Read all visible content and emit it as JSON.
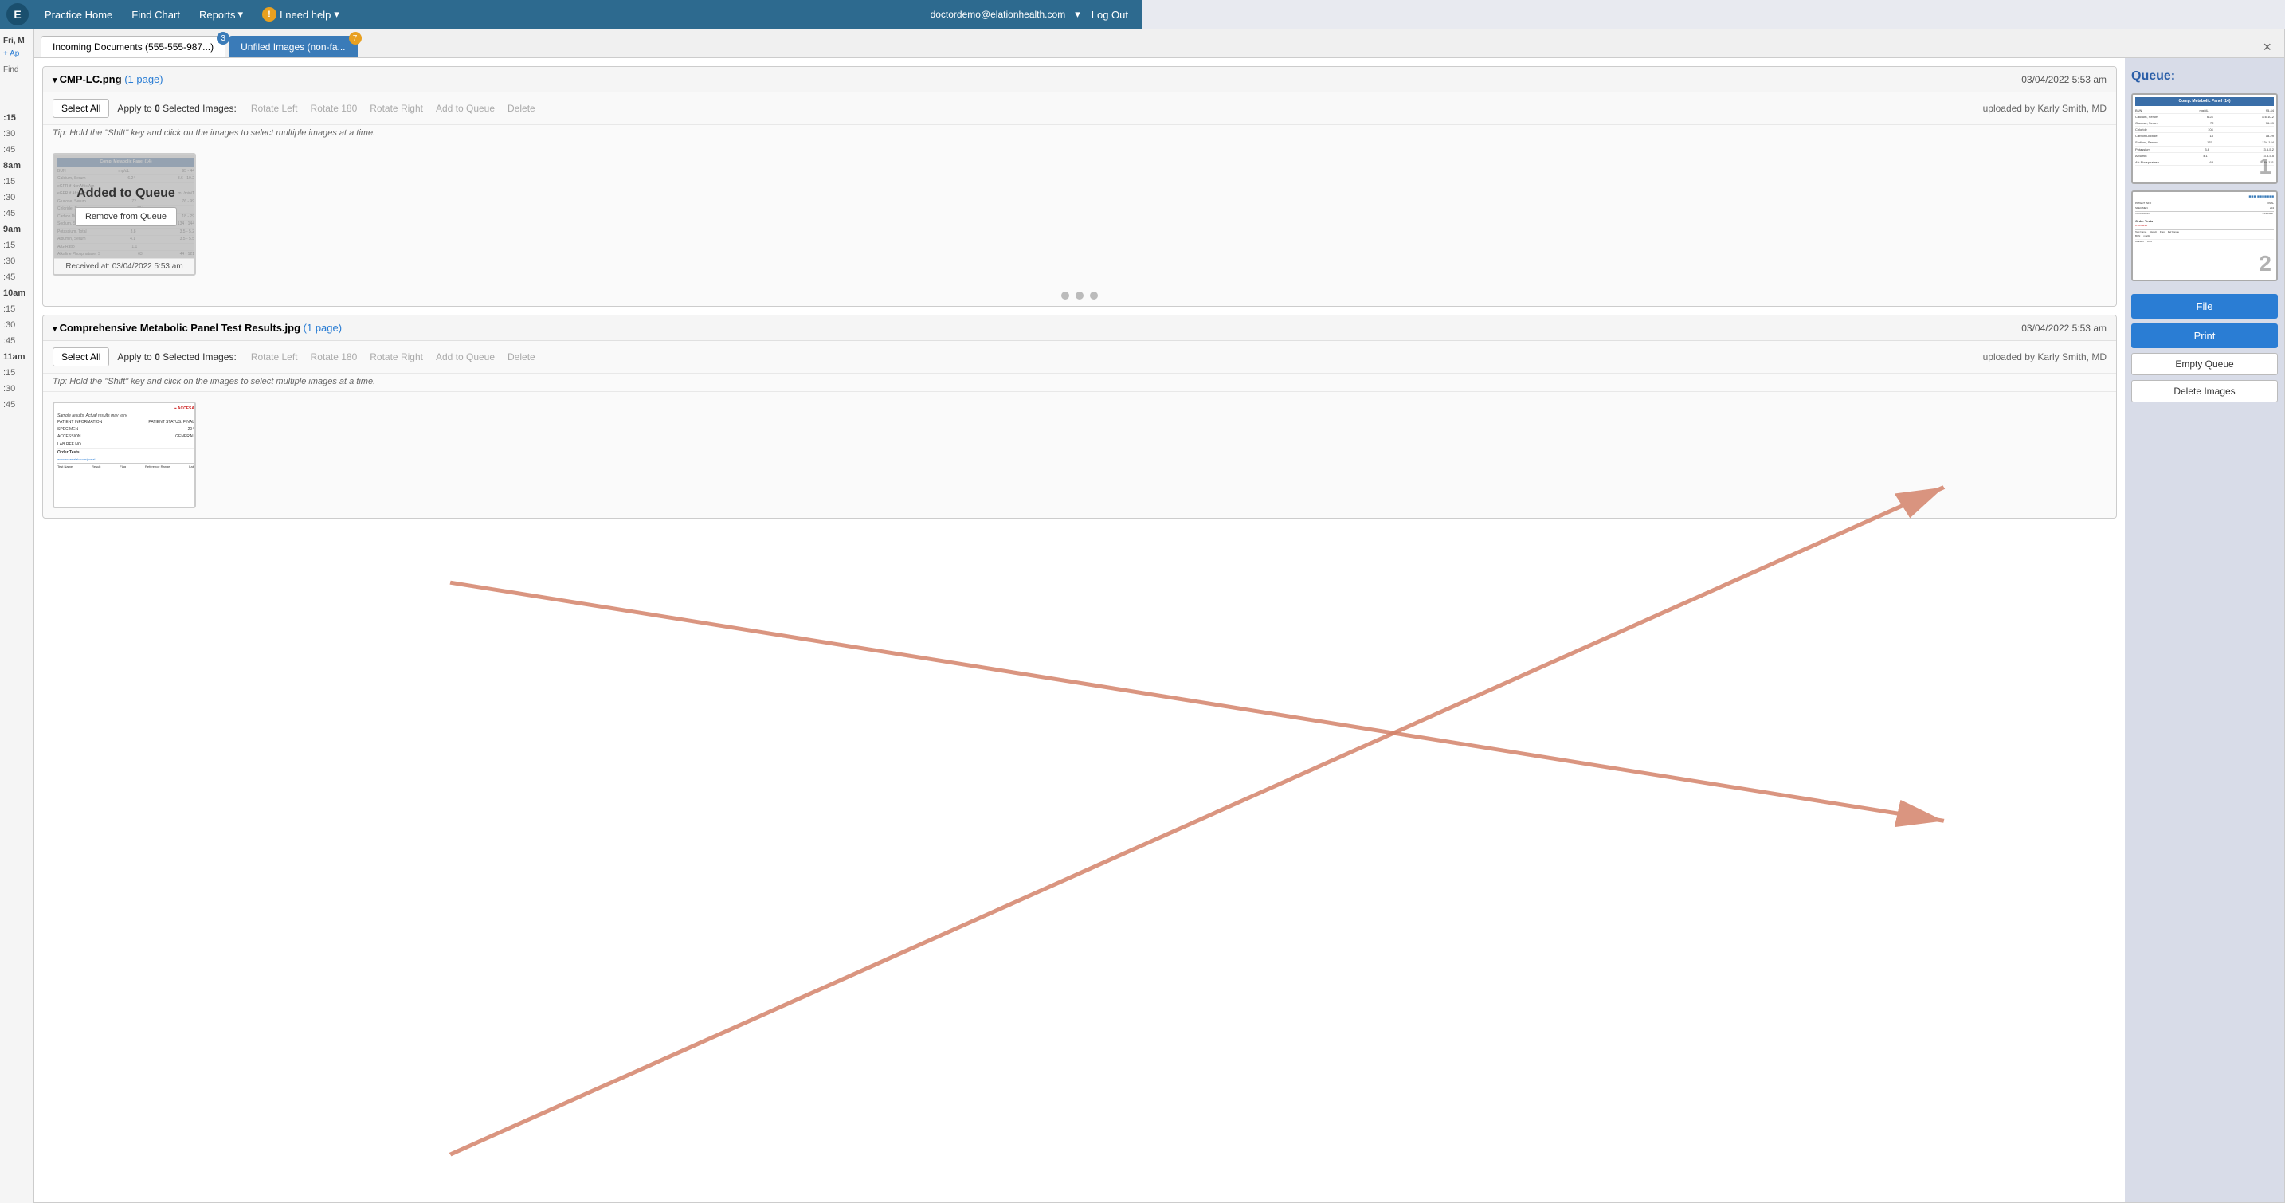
{
  "nav": {
    "logo": "E",
    "links": [
      {
        "label": "Practice Home",
        "id": "practice-home"
      },
      {
        "label": "Find Chart",
        "id": "find-chart"
      },
      {
        "label": "Reports",
        "id": "reports",
        "dropdown": true
      },
      {
        "label": "I need help",
        "id": "i-need-help",
        "dropdown": true,
        "has_help_icon": true
      }
    ],
    "user_email": "doctordemo@elationhealth.com",
    "logout_label": "Log Out"
  },
  "tabs": [
    {
      "label": "Incoming Documents (555-555-987...)",
      "id": "incoming-docs",
      "badge": "3",
      "active": false
    },
    {
      "label": "Unfiled Images (non-fa...",
      "id": "unfiled-images",
      "badge": "7",
      "active": true
    }
  ],
  "close_button": "×",
  "sidebar": {
    "fri_label": "Fri, M",
    "add_ap_label": "+ Ap",
    "find_label": "Find"
  },
  "documents": [
    {
      "id": "doc1",
      "title": "CMP-LC.png",
      "page_info": "(1 page)",
      "timestamp": "03/04/2022 5:53 am",
      "select_all_label": "Select All",
      "apply_label": "Apply to",
      "selected_count": "0",
      "selected_suffix": "Selected Images:",
      "actions": [
        "Rotate Left",
        "Rotate 180",
        "Rotate Right",
        "Add to Queue",
        "Delete"
      ],
      "uploaded_by": "uploaded by Karly Smith, MD",
      "tip": "Tip: Hold the \"Shift\" key and click on the images to select multiple images at a time.",
      "image_caption": "Received at: 03/04/2022 5:53 am",
      "added_to_queue": true,
      "added_to_queue_label": "Added to Queue",
      "remove_from_queue_label": "Remove from Queue",
      "pagination_dots": 3
    },
    {
      "id": "doc2",
      "title": "Comprehensive Metabolic Panel Test Results.jpg",
      "page_info": "(1 page)",
      "timestamp": "03/04/2022 5:53 am",
      "select_all_label": "Select All",
      "apply_label": "Apply to",
      "selected_count": "0",
      "selected_suffix": "Selected Images:",
      "actions": [
        "Rotate Left",
        "Rotate 180",
        "Rotate Right",
        "Add to Queue",
        "Delete"
      ],
      "uploaded_by": "uploaded by Karly Smith, MD",
      "tip": "Tip: Hold the \"Shift\" key and click on the images to select multiple images at a time.",
      "added_to_queue": false
    }
  ],
  "queue": {
    "title": "Queue:",
    "items": [
      {
        "id": "queue-item-1",
        "number": "1"
      },
      {
        "id": "queue-item-2",
        "number": "2"
      }
    ],
    "buttons": [
      {
        "label": "File",
        "type": "primary",
        "id": "file-btn"
      },
      {
        "label": "Print",
        "type": "primary",
        "id": "print-btn"
      },
      {
        "label": "Empty Queue",
        "type": "secondary",
        "id": "empty-queue-btn"
      },
      {
        "label": "Delete Images",
        "type": "secondary",
        "id": "delete-images-btn"
      }
    ]
  }
}
